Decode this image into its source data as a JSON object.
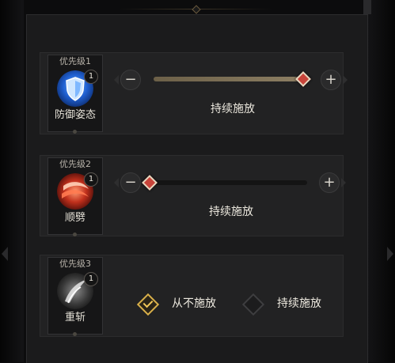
{
  "skills": [
    {
      "priority": "优先级1",
      "name": "防御姿态",
      "level": "1",
      "icon": "shield-icon",
      "mode_label": "持续施放",
      "slider_value": 1.0
    },
    {
      "priority": "优先级2",
      "name": "顺劈",
      "level": "1",
      "icon": "cleave-slash-icon",
      "mode_label": "持续施放",
      "slider_value": 0.0
    },
    {
      "priority": "优先级3",
      "name": "重斩",
      "level": "1",
      "icon": "heavy-slash-icon",
      "options": [
        {
          "label": "从不施放",
          "checked": true
        },
        {
          "label": "持续施放",
          "checked": false
        }
      ]
    }
  ],
  "colors": {
    "accent_gold": "#d9b04a",
    "handle_red": "#c8443a",
    "panel_bg": "#1b1b1c"
  },
  "slider_buttons": {
    "minus": "−",
    "plus": "+"
  }
}
